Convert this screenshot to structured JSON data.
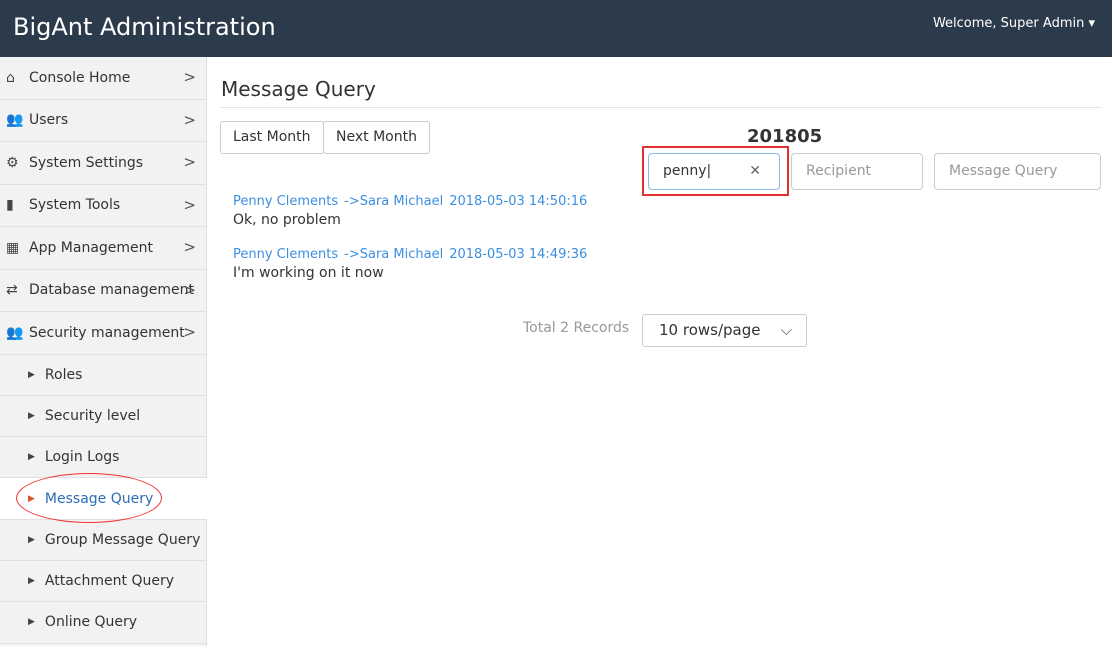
{
  "header": {
    "title": "BigAnt Administration",
    "welcome": "Welcome, Super Admin ▾"
  },
  "sidebar": {
    "items": [
      {
        "label": "Console Home",
        "icon": "home-icon",
        "glyph": "⌂"
      },
      {
        "label": "Users",
        "icon": "users-icon",
        "glyph": "👥"
      },
      {
        "label": "System Settings",
        "icon": "gears-icon",
        "glyph": "⚙"
      },
      {
        "label": "System Tools",
        "icon": "briefcase-icon",
        "glyph": "▮"
      },
      {
        "label": "App Management",
        "icon": "grid-icon",
        "glyph": "▦"
      },
      {
        "label": "Database management",
        "icon": "retweet-icon",
        "glyph": "⇄"
      },
      {
        "label": "Security management",
        "icon": "users-icon",
        "glyph": "👥"
      }
    ],
    "subitems": [
      "Roles",
      "Security level",
      "Login Logs",
      "Message Query",
      "Group Message Query",
      "Attachment Query",
      "Online Query"
    ],
    "active": "Message Query"
  },
  "main": {
    "title": "Message Query",
    "last_month": "Last Month",
    "next_month": "Next Month",
    "month": "201805",
    "sender_value": "penny",
    "recipient_placeholder": "Recipient",
    "query_placeholder": "Message Query",
    "messages": [
      {
        "sender": "Penny Clements",
        "recipient": "->Sara Michael",
        "time": "2018-05-03 14:50:16",
        "text": "Ok, no problem"
      },
      {
        "sender": "Penny Clements",
        "recipient": "->Sara Michael",
        "time": "2018-05-03 14:49:36",
        "text": "I'm working on it now"
      }
    ],
    "total": "Total 2 Records",
    "page_size": "10 rows/page"
  }
}
